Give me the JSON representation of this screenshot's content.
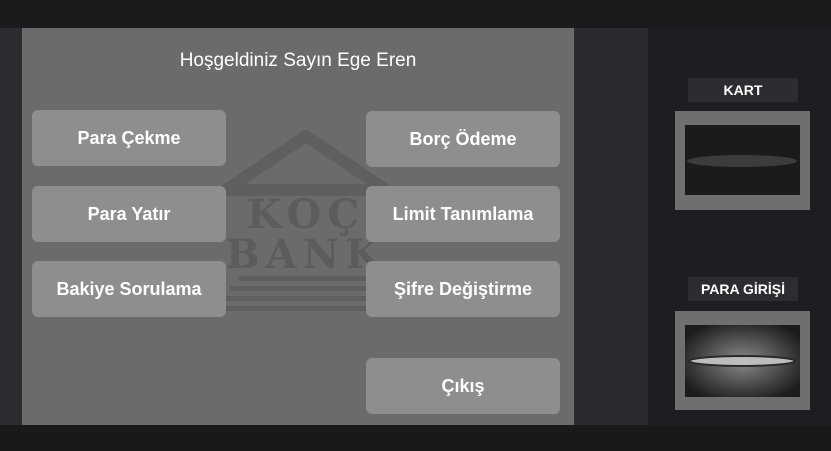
{
  "screen": {
    "welcome": "Hoşgeldiniz Sayın Ege Eren",
    "watermark": {
      "line1": "KOÇ",
      "line2": "BANK"
    }
  },
  "buttons": {
    "left": [
      {
        "label": "Para Çekme"
      },
      {
        "label": "Para Yatır"
      },
      {
        "label": "Bakiye Sorulama"
      }
    ],
    "right": [
      {
        "label": "Borç Ödeme"
      },
      {
        "label": "Limit Tanımlama"
      },
      {
        "label": "Şifre Değiştirme"
      },
      {
        "label": "Çıkış"
      }
    ]
  },
  "hardware": {
    "card_label": "KART",
    "cash_label": "PARA GİRİŞİ"
  }
}
